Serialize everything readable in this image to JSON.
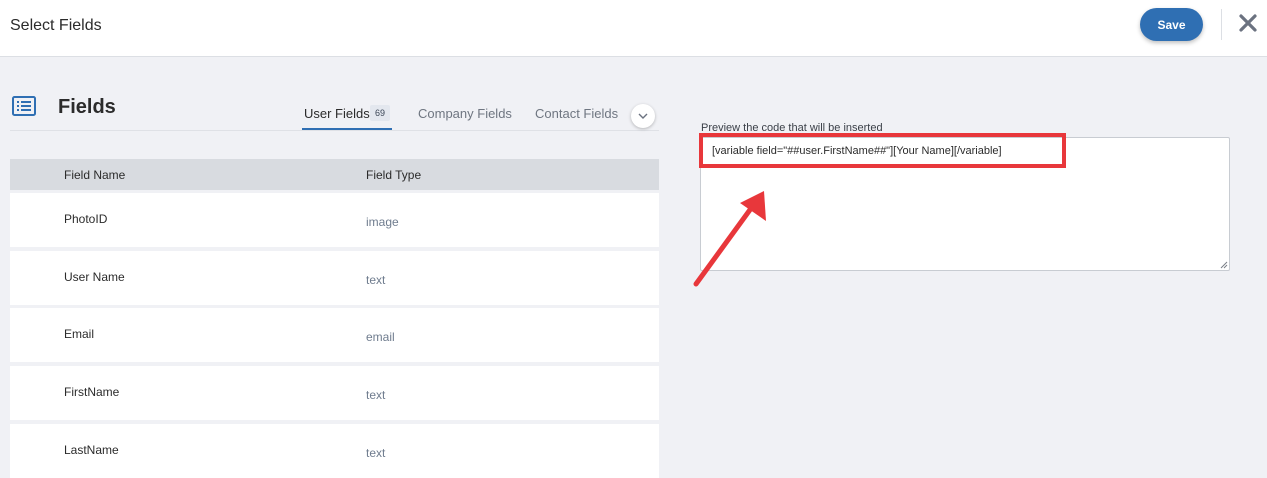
{
  "dialog": {
    "title": "Select Fields",
    "save_label": "Save"
  },
  "panel": {
    "heading": "Fields",
    "tabs": [
      {
        "label": "User Fields",
        "count": "69",
        "active": true
      },
      {
        "label": "Company Fields",
        "active": false
      },
      {
        "label": "Contact Fields",
        "active": false
      }
    ]
  },
  "table": {
    "headers": {
      "name": "Field Name",
      "type": "Field Type"
    },
    "rows": [
      {
        "name": "PhotoID",
        "type": "image"
      },
      {
        "name": "User Name",
        "type": "text"
      },
      {
        "name": "Email",
        "type": "email"
      },
      {
        "name": "FirstName",
        "type": "text"
      },
      {
        "name": "LastName",
        "type": "text"
      }
    ]
  },
  "preview": {
    "label": "Preview the code that will be inserted",
    "code": "[variable field=\"##user.FirstName##\"][Your Name][/variable]"
  },
  "colors": {
    "accent": "#2f6fb3",
    "annotation": "#e8373b",
    "background": "#f0f1f5"
  },
  "icons": {
    "close": "close-icon",
    "fields": "list-icon",
    "tabs_more": "chevron-down-icon"
  }
}
